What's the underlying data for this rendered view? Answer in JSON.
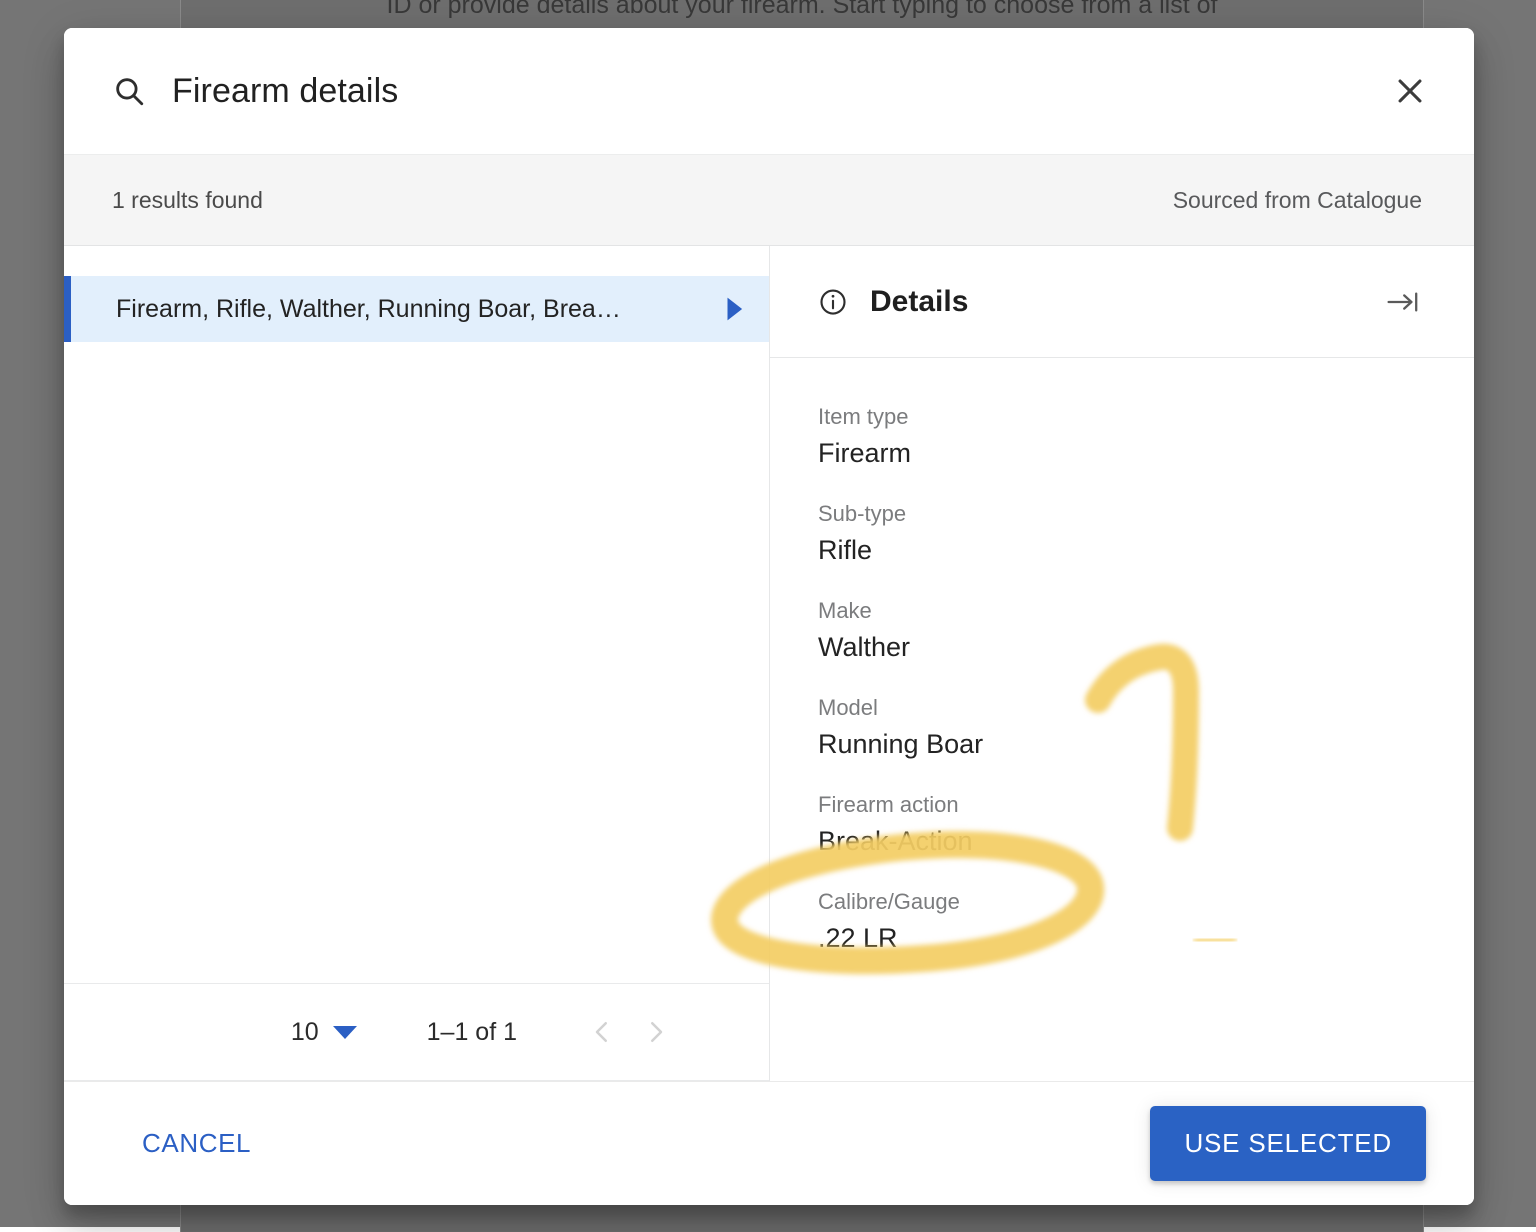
{
  "background": {
    "obscured_text": "ID or provide details about your firearm. Start typing to choose from a list of"
  },
  "dialog": {
    "title": "Firearm details",
    "search_icon": "search-icon",
    "close_icon": "close-icon"
  },
  "results_bar": {
    "count_text": "1 results found",
    "source_text": "Sourced from Catalogue"
  },
  "list": {
    "items": [
      {
        "label": "Firearm, Rifle, Walther, Running Boar, Brea…",
        "selected": true,
        "chevron_icon": "caret-right-icon"
      }
    ]
  },
  "paginator": {
    "page_size": "10",
    "page_size_caret_icon": "caret-down-icon",
    "range_text": "1–1 of 1",
    "prev_icon": "chevron-left-icon",
    "next_icon": "chevron-right-icon"
  },
  "details": {
    "header": {
      "info_icon": "info-circle-icon",
      "title": "Details",
      "collapse_icon": "arrow-to-right-icon"
    },
    "fields": [
      {
        "label": "Item type",
        "value": "Firearm"
      },
      {
        "label": "Sub-type",
        "value": "Rifle"
      },
      {
        "label": "Make",
        "value": "Walther"
      },
      {
        "label": "Model",
        "value": "Running Boar"
      },
      {
        "label": "Firearm action",
        "value": "Break-Action"
      },
      {
        "label": "Calibre/Gauge",
        "value": ".22 LR"
      }
    ]
  },
  "footer": {
    "cancel_label": "CANCEL",
    "use_selected_label": "USE SELECTED"
  },
  "colors": {
    "accent_blue": "#2b5fc4",
    "primary_button": "#2a62c4",
    "selected_row_bg": "#e2effc",
    "results_bar_bg": "#f5f5f5",
    "backdrop": "#6e6e6e",
    "highlighter_yellow": "#f3ce63"
  },
  "annotations": [
    {
      "name": "oval-around-firearm-action",
      "shape": "ellipse-stroke",
      "color": "#f3ce63"
    },
    {
      "name": "arrow-seven-stroke",
      "shape": "polyline",
      "color": "#f3ce63"
    },
    {
      "name": "small-dash-stroke",
      "shape": "dash",
      "color": "#f3ce63"
    }
  ]
}
